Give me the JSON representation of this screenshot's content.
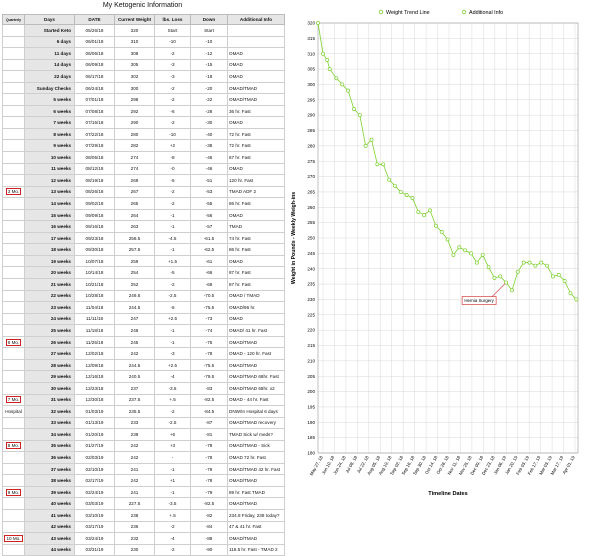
{
  "sheet": {
    "title": "My Ketogenic Information",
    "columns": [
      "Quarterly",
      "Days",
      "DATE",
      "Current Weight",
      "lbs. Loss",
      "Down",
      "Additional Info"
    ],
    "rows": [
      [
        "",
        "Started Keto",
        "05/26/18",
        "320",
        "Start",
        "Start",
        ""
      ],
      [
        "",
        "6 days",
        "06/01/18",
        "310",
        "-10",
        "-10",
        ""
      ],
      [
        "",
        "11 days",
        "06/06/18",
        "308",
        "-2",
        "-12",
        "OMAD"
      ],
      [
        "",
        "14 days",
        "06/09/18",
        "305",
        "-3",
        "-15",
        "OMAD"
      ],
      [
        "",
        "22 days",
        "06/17/18",
        "302",
        "-3",
        "-18",
        "OMAD"
      ],
      [
        "",
        "Sunday Checks",
        "06/24/18",
        "300",
        "-2",
        "-20",
        "OMAD/TMAD"
      ],
      [
        "",
        "5 weeks",
        "07/01/18",
        "298",
        "-2",
        "-22",
        "OMAD/TMAD"
      ],
      [
        "",
        "6 weeks",
        "07/08/18",
        "292",
        "-6",
        "-28",
        "36 hr. Fast"
      ],
      [
        "",
        "7 weeks",
        "07/15/18",
        "290",
        "-2",
        "-30",
        "OMAD"
      ],
      [
        "",
        "8 weeks",
        "07/22/18",
        "280",
        "-10",
        "-40",
        "72 hr. Fast"
      ],
      [
        "",
        "9 weeks",
        "07/29/18",
        "282",
        "+2",
        "-38",
        "72 hr. Fast"
      ],
      [
        "",
        "10 weeks",
        "08/05/18",
        "274",
        "-8",
        "-46",
        "67 hr. Fast"
      ],
      [
        "",
        "11 weeks",
        "08/12/18",
        "274",
        "-0",
        "-46",
        "OMAD"
      ],
      [
        "",
        "12 weeks",
        "08/19/18",
        "269",
        "-5",
        "-51",
        "120 hr. Fast"
      ],
      [
        "3 Mo.",
        "13 weeks",
        "08/26/18",
        "267",
        "-2",
        "-53",
        "TMAD ADF 2"
      ],
      [
        "",
        "14 weeks",
        "09/02/18",
        "265",
        "-2",
        "-55",
        "86 hr. Fast"
      ],
      [
        "",
        "15 weeks",
        "09/09/18",
        "264",
        "-1",
        "-56",
        "OMAD"
      ],
      [
        "",
        "16 weeks",
        "09/16/18",
        "263",
        "-1",
        "-57",
        "TMAD"
      ],
      [
        "",
        "17 weeks",
        "09/23/18",
        "258.5",
        "-4.5",
        "-61.5",
        "74 hr. Fast"
      ],
      [
        "",
        "18 weeks",
        "09/30/18",
        "257.5",
        "-1",
        "-62.5",
        "86 hr. Fast"
      ],
      [
        "",
        "19 weeks",
        "10/07/18",
        "259",
        "+1.5",
        "-61",
        "OMAD"
      ],
      [
        "",
        "20 weeks",
        "10/14/18",
        "254",
        "-5",
        "-66",
        "87 hr. Fast"
      ],
      [
        "",
        "21 weeks",
        "10/21/18",
        "252",
        "-2",
        "-68",
        "87 hr. Fast"
      ],
      [
        "",
        "22 weeks",
        "10/28/18",
        "249.5",
        "-2.5",
        "-70.5",
        "OMAD / TMAD"
      ],
      [
        "",
        "23 weeks",
        "11/04/18",
        "244.5",
        "-5",
        "-75.5",
        "OMAD/96 hr."
      ],
      [
        "",
        "24 weeks",
        "11/11/18",
        "247",
        "+2.5",
        "-73",
        "OMAD"
      ],
      [
        "",
        "25 weeks",
        "11/18/18",
        "246",
        "-1",
        "-74",
        "OMAD/ 41 hr. Fast"
      ],
      [
        "6 Mo.",
        "26 weeks",
        "11/25/18",
        "245",
        "-1",
        "-75",
        "OMAD/TMAD"
      ],
      [
        "",
        "27 weeks",
        "12/02/18",
        "242",
        "-3",
        "-78",
        "OMAD - 120 hr. Fast"
      ],
      [
        "",
        "28 weeks",
        "12/09/18",
        "244.5",
        "+2.5",
        "-75.5",
        "OMAD/TMAD"
      ],
      [
        "",
        "29 weeks",
        "12/16/18",
        "240.5",
        "-4",
        "-79.5",
        "OMAD/TMAD 68hr. Fast"
      ],
      [
        "",
        "30 weeks",
        "12/23/18",
        "237",
        "-3.5",
        "-83",
        "OMAD/TMAD 68hr. x2"
      ],
      [
        "7 Mo.",
        "31 weeks",
        "12/30/18",
        "237.5",
        "+.5",
        "-82.5",
        "OMAD - 44 hr. Fast"
      ],
      [
        "Hospital",
        "32 weeks",
        "01/03/19",
        "235.5",
        "-2",
        "-84.5",
        "DNW/In Hospital 6 days"
      ],
      [
        "",
        "33 weeks",
        "01/13/19",
        "233",
        "-2.5",
        "-87",
        "OMAD/TMAD recovery"
      ],
      [
        "",
        "34 weeks",
        "01/20/19",
        "239",
        "+6",
        "-81",
        "TMAD Sick w/ meds?"
      ],
      [
        "8 Mo.",
        "35 weeks",
        "01/27/19",
        "242",
        "+3",
        "-78",
        "OMAD/TMAD - Sick"
      ],
      [
        "",
        "36 weeks",
        "02/03/19",
        "242",
        "-",
        "-78",
        "OMAD 72 hr. Fast"
      ],
      [
        "",
        "37 weeks",
        "02/10/19",
        "241",
        "-1",
        "-79",
        "OMAD/TMAD 42 hr. Fast"
      ],
      [
        "",
        "38 weeks",
        "02/17/19",
        "242",
        "+1",
        "-78",
        "OMAD/TMAD"
      ],
      [
        "9 Mo.",
        "39 weeks",
        "02/24/19",
        "241",
        "-1",
        "-79",
        "89 hr. Fast TMAD"
      ],
      [
        "",
        "40 weeks",
        "03/03/19",
        "227.5",
        "-3.5",
        "-82.5",
        "OMAD/TMAD"
      ],
      [
        "",
        "41 weeks",
        "03/10/19",
        "238",
        "+.5",
        "-82",
        "234.8 Friday, 238 today?"
      ],
      [
        "",
        "42 weeks",
        "03/17/19",
        "236",
        "-2",
        "-84",
        "47 & 41 hr. Fast"
      ],
      [
        "10 Mo.",
        "43 weeks",
        "03/24/19",
        "232",
        "-4",
        "-88",
        "OMAD/TMAD"
      ],
      [
        "",
        "44 weeks",
        "03/31/19",
        "230",
        "-2",
        "-90",
        "116.5 hr. Fast - TMAD 2"
      ]
    ]
  },
  "chart_data": {
    "type": "line",
    "legend": [
      "Weight Trend Line",
      "Additional Info"
    ],
    "legend_position": "top",
    "xlabel": "Timeline Dates",
    "ylabel": "Weight in Pounds - Weekly Weigh-ins",
    "ylim": [
      180,
      320
    ],
    "yticks": [
      180,
      185,
      190,
      195,
      200,
      205,
      210,
      215,
      220,
      225,
      230,
      235,
      240,
      245,
      250,
      255,
      260,
      265,
      270,
      275,
      280,
      285,
      290,
      295,
      300,
      305,
      310,
      315,
      320
    ],
    "grid": true,
    "x_tick_labels": [
      "May 27, 18",
      "Jun 10, 18",
      "Jun 24, 18",
      "Jul 08, 18",
      "Jul 22, 18",
      "Aug 05, 18",
      "Aug 19, 18",
      "Sep 02, 18",
      "Sep 16, 18",
      "Sep 30, 18",
      "Oct 14, 18",
      "Oct 28, 18",
      "Nov 11, 18",
      "Nov 25, 18",
      "Dec 09, 18",
      "Dec 23, 18",
      "Jan 06, 19",
      "Jan 20, 19",
      "Feb 03, 19",
      "Feb 17, 19",
      "Mar 03, 19",
      "Mar 17, 19",
      "Apr 01, 19"
    ],
    "series": [
      {
        "name": "Weight Trend Line",
        "color": "#7cd02f",
        "x": [
          "2018-05-26",
          "2018-06-01",
          "2018-06-06",
          "2018-06-09",
          "2018-06-17",
          "2018-06-24",
          "2018-07-01",
          "2018-07-08",
          "2018-07-15",
          "2018-07-22",
          "2018-07-29",
          "2018-08-05",
          "2018-08-12",
          "2018-08-19",
          "2018-08-26",
          "2018-09-02",
          "2018-09-09",
          "2018-09-16",
          "2018-09-23",
          "2018-09-30",
          "2018-10-07",
          "2018-10-14",
          "2018-10-21",
          "2018-10-28",
          "2018-11-04",
          "2018-11-11",
          "2018-11-18",
          "2018-11-25",
          "2018-12-02",
          "2018-12-09",
          "2018-12-16",
          "2018-12-23",
          "2018-12-30",
          "2019-01-06",
          "2019-01-13",
          "2019-01-20",
          "2019-01-27",
          "2019-02-03",
          "2019-02-10",
          "2019-02-17",
          "2019-02-24",
          "2019-03-03",
          "2019-03-10",
          "2019-03-17",
          "2019-03-24",
          "2019-03-31"
        ],
        "y": [
          320,
          310,
          308,
          305,
          302,
          300,
          298,
          292,
          290,
          280,
          282,
          274,
          274,
          269,
          267,
          265,
          264,
          263,
          258.5,
          257.5,
          259,
          254,
          252,
          249.5,
          244.5,
          247,
          246,
          245,
          242,
          244.5,
          240.5,
          237,
          237.5,
          235.5,
          233,
          239,
          242,
          242,
          241,
          242,
          241,
          237.5,
          238,
          236,
          232,
          230
        ]
      }
    ],
    "annotations": [
      {
        "text": "Hernia Surgery",
        "x": "2019-01-06",
        "y": 235.5
      }
    ]
  }
}
